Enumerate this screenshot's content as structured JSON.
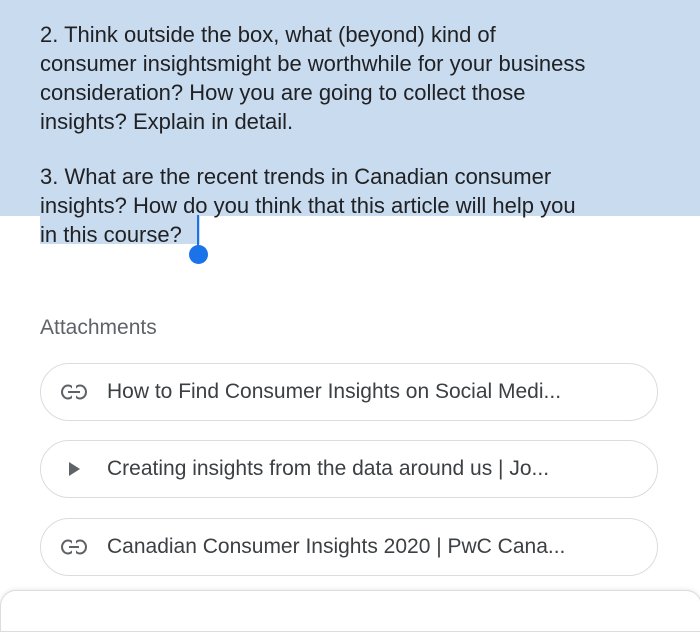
{
  "question2": [
    "2. Think outside the box, what (beyond) kind of",
    "consumer insightsmight be worthwhile for your business",
    "consideration? How you are going to collect those",
    "insights? Explain in detail."
  ],
  "question3": [
    "3. What are the recent trends in Canadian consumer",
    "insights? How do you think that this article will help you",
    "in this course?"
  ],
  "attachments": {
    "title": "Attachments",
    "items": [
      {
        "icon": "link-icon",
        "label": "How to Find Consumer Insights on Social Medi..."
      },
      {
        "icon": "play-icon",
        "label": "Creating insights from the data around us | Jo..."
      },
      {
        "icon": "link-icon",
        "label": "Canadian Consumer Insights 2020 | PwC Cana..."
      }
    ]
  },
  "colors": {
    "selection": "#c9dbee",
    "cursor": "#1a73e8",
    "chip_border": "#dadce0"
  }
}
